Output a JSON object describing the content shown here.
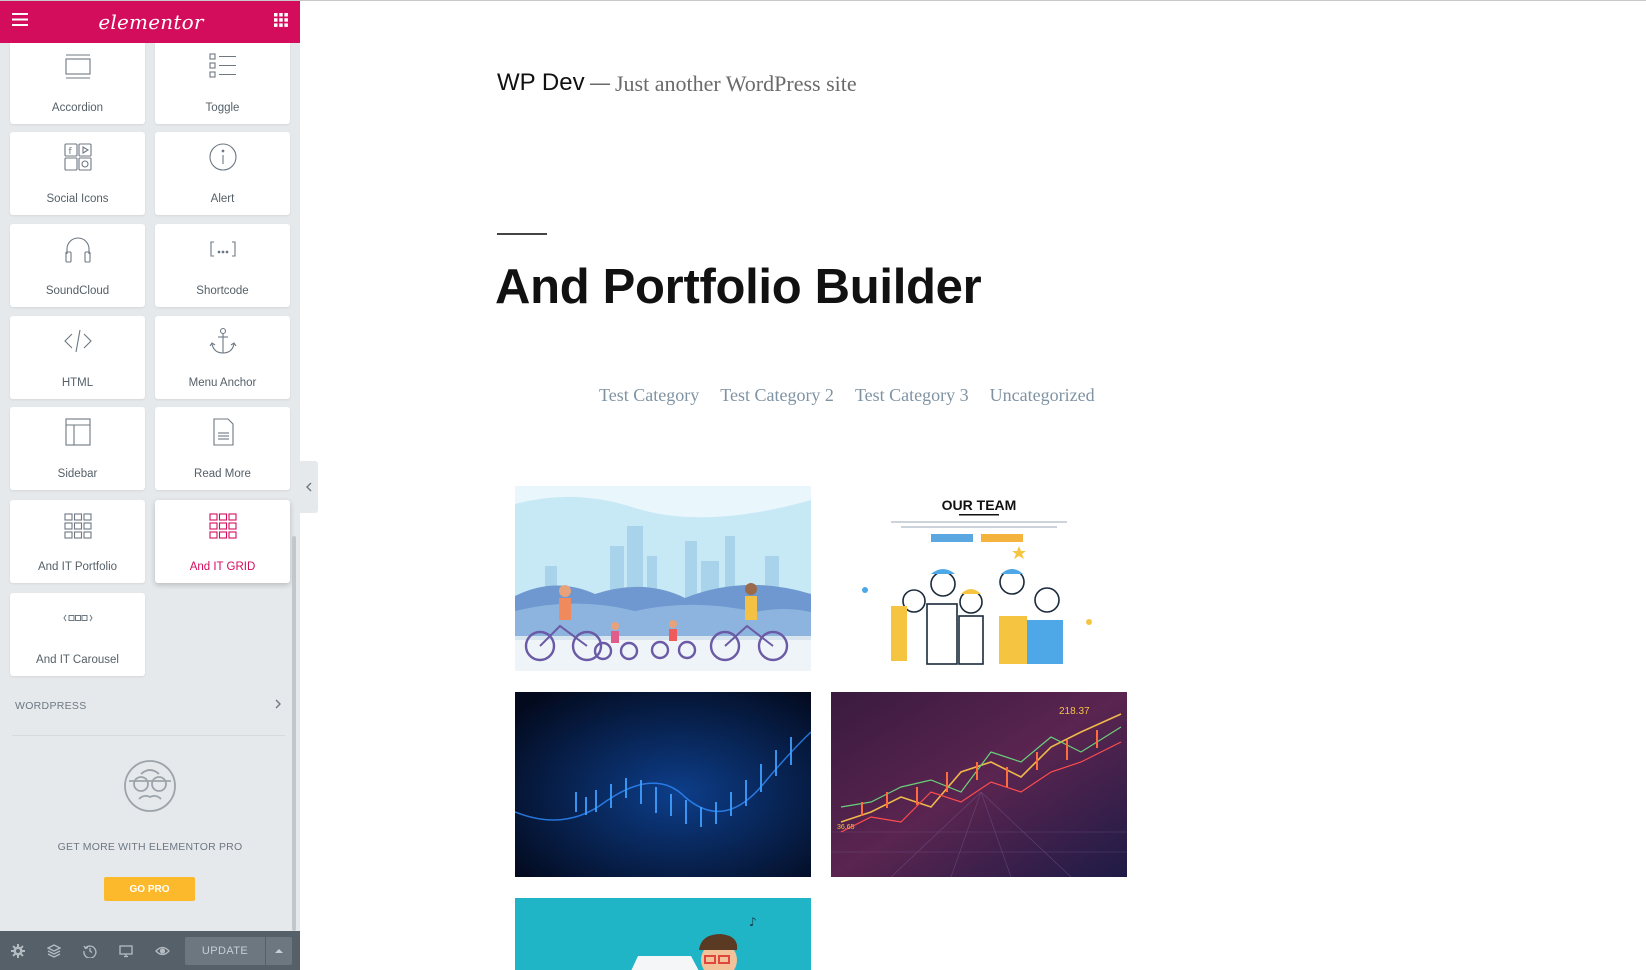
{
  "panel": {
    "logo": "elementor",
    "widgets": [
      {
        "label": "Accordion",
        "icon": "accordion-icon"
      },
      {
        "label": "Toggle",
        "icon": "toggle-icon"
      },
      {
        "label": "Social Icons",
        "icon": "social-icons-icon"
      },
      {
        "label": "Alert",
        "icon": "alert-icon"
      },
      {
        "label": "SoundCloud",
        "icon": "headphones-icon"
      },
      {
        "label": "Shortcode",
        "icon": "shortcode-icon"
      },
      {
        "label": "HTML",
        "icon": "code-icon"
      },
      {
        "label": "Menu Anchor",
        "icon": "anchor-icon"
      },
      {
        "label": "Sidebar",
        "icon": "sidebar-icon"
      },
      {
        "label": "Read More",
        "icon": "read-more-icon"
      },
      {
        "label": "And IT Portfolio",
        "icon": "grid-icon"
      },
      {
        "label": "And IT GRID",
        "icon": "grid-icon"
      },
      {
        "label": "And IT Carousel",
        "icon": "carousel-icon"
      }
    ],
    "wordpress_section": "WORDPRESS",
    "pro_text": "GET MORE WITH ELEMENTOR PRO",
    "go_pro": "GO PRO",
    "update": "UPDATE",
    "accent_color": "#d30c5c",
    "go_pro_color": "#fcb92c"
  },
  "site": {
    "title": "WP Dev",
    "separator": "—",
    "tagline": "Just another WordPress site"
  },
  "page": {
    "title": "And Portfolio Builder",
    "categories": [
      "Test Category",
      "Test Category 2",
      "Test Category 3",
      "Uncategorized"
    ]
  },
  "portfolio": {
    "our_team_heading": "OUR TEAM",
    "stock_value": "218.37",
    "stock_side_value": "36.65"
  }
}
